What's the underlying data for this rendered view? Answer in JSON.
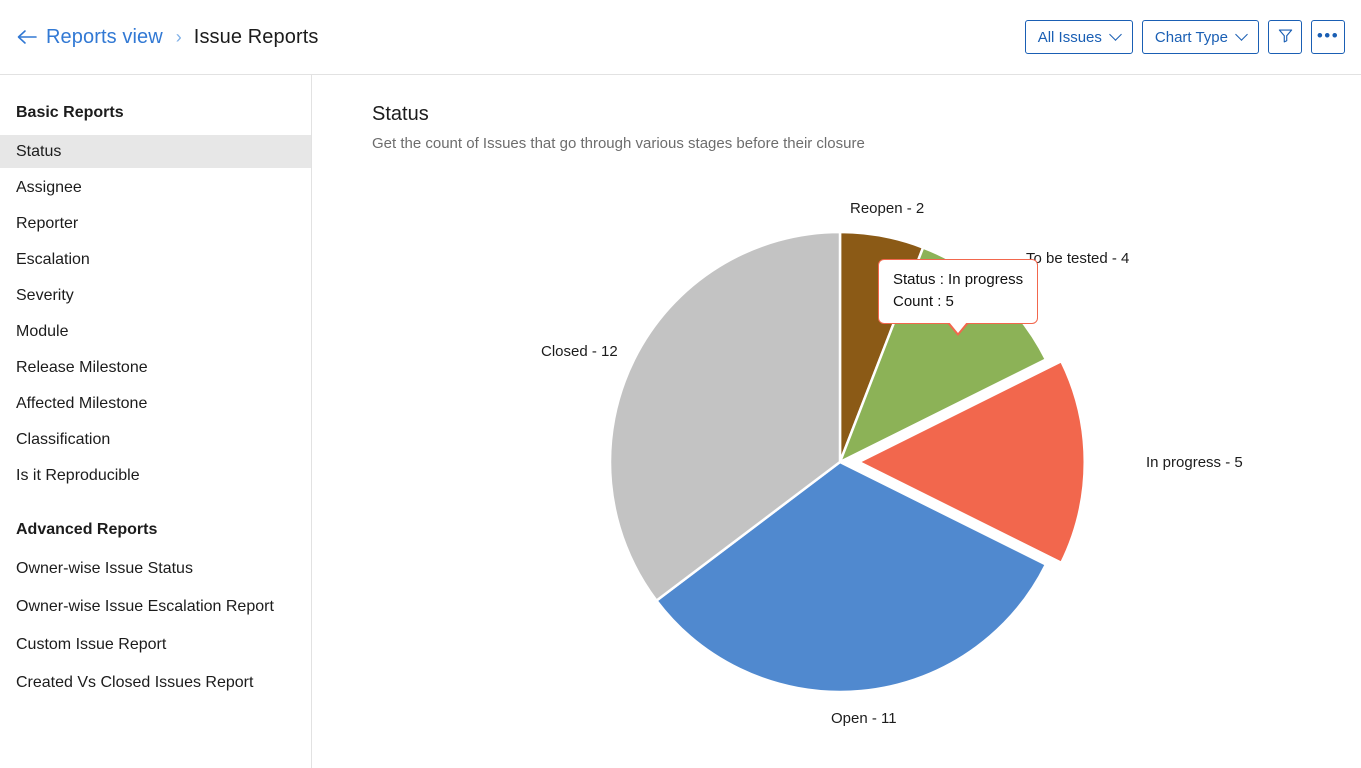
{
  "header": {
    "back_icon": "back-arrow-icon",
    "breadcrumb_parent": "Reports view",
    "breadcrumb_separator": "›",
    "breadcrumb_current": "Issue Reports",
    "buttons": {
      "all_issues": "All Issues",
      "chart_type": "Chart Type",
      "filter_icon": "funnel-filter-icon",
      "more_label": "•••"
    }
  },
  "sidebar": {
    "basic_title": "Basic Reports",
    "basic_items": [
      "Status",
      "Assignee",
      "Reporter",
      "Escalation",
      "Severity",
      "Module",
      "Release Milestone",
      "Affected Milestone",
      "Classification",
      "Is it Reproducible"
    ],
    "active_item": "Status",
    "advanced_title": "Advanced Reports",
    "advanced_items": [
      "Owner-wise Issue Status",
      "Owner-wise Issue Escalation Report",
      "Custom Issue Report",
      "Created Vs Closed Issues Report"
    ]
  },
  "main": {
    "title": "Status",
    "subtitle": "Get the count of Issues that go through various stages before their closure"
  },
  "tooltip": {
    "status_line": "Status : In progress",
    "count_line": "Count : 5",
    "border_color": "#f2674d"
  },
  "chart_data": {
    "type": "pie",
    "title": "Status",
    "subtitle": "Get the count of Issues that go through various stages before their closure",
    "total": 34,
    "start_angle_deg": 0,
    "direction": "clockwise",
    "categories": [
      "Reopen",
      "To be tested",
      "In progress",
      "Open",
      "Closed"
    ],
    "values": [
      2,
      4,
      5,
      11,
      12
    ],
    "labels": [
      "Reopen - 2",
      "To be tested - 4",
      "In progress - 5",
      "Open - 11",
      "Closed - 12"
    ],
    "colors": [
      "#8b5a16",
      "#8cb257",
      "#f2674d",
      "#5089cf",
      "#c3c3c3"
    ],
    "exploded_slice": "In progress",
    "legend": "none",
    "slice_gap": true
  }
}
